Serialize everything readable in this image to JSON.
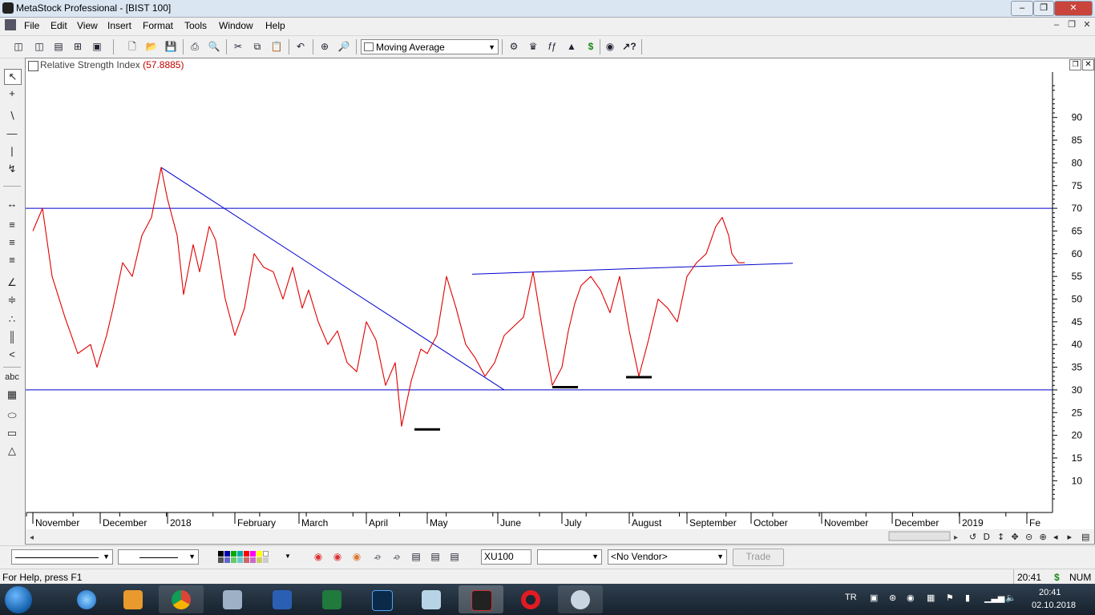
{
  "window": {
    "title": "MetaStock Professional - [BIST 100]"
  },
  "menubar": {
    "items": [
      "File",
      "Edit",
      "View",
      "Insert",
      "Format",
      "Tools",
      "Window",
      "Help"
    ]
  },
  "toolbar": {
    "indicator_select": "Moving Average"
  },
  "chart": {
    "title": "Relative Strength Index",
    "value_display": "(57.8885)",
    "line_color": "#e00000",
    "overlay_color": "#0000cc",
    "bg_color": "#ffffff"
  },
  "chart_data": {
    "type": "line",
    "title": "Relative Strength Index",
    "y_axis_position": "right",
    "ylim": [
      3,
      100
    ],
    "y_ticks": [
      10,
      15,
      20,
      25,
      30,
      35,
      40,
      45,
      50,
      55,
      60,
      65,
      70,
      75,
      80,
      85,
      90
    ],
    "x_tick_labels": [
      {
        "label": "November",
        "x": 0
      },
      {
        "label": "December",
        "x": 21
      },
      {
        "label": "2018",
        "x": 42
      },
      {
        "label": "February",
        "x": 63
      },
      {
        "label": "March",
        "x": 83
      },
      {
        "label": "April",
        "x": 104
      },
      {
        "label": "May",
        "x": 123
      },
      {
        "label": "June",
        "x": 145
      },
      {
        "label": "July",
        "x": 165
      },
      {
        "label": "August",
        "x": 186
      },
      {
        "label": "September",
        "x": 204
      },
      {
        "label": "October",
        "x": 224
      },
      {
        "label": "November",
        "x": 246
      },
      {
        "label": "December",
        "x": 268
      },
      {
        "label": "2019",
        "x": 289
      },
      {
        "label": "Fe",
        "x": 310
      }
    ],
    "series": [
      {
        "x": [
          0,
          3,
          6,
          10,
          14,
          18,
          20,
          23,
          25,
          28,
          31,
          34,
          37,
          40,
          42,
          45,
          47,
          50,
          52,
          55,
          57,
          60,
          63,
          66,
          69,
          72,
          75,
          78,
          81,
          84,
          86,
          89,
          92,
          95,
          98,
          101,
          104,
          107,
          110,
          113,
          115,
          118,
          121,
          123,
          126,
          129,
          132,
          135,
          138,
          141,
          144,
          147,
          150,
          153,
          156,
          159,
          162,
          165,
          167,
          169,
          171,
          174,
          177,
          180,
          183,
          186,
          189,
          192,
          195,
          198,
          201,
          204,
          207,
          210,
          213,
          215,
          217,
          218,
          220,
          222
        ],
        "y": [
          65,
          70,
          55,
          46,
          38,
          40,
          35,
          42,
          48,
          58,
          55,
          64,
          68,
          79,
          72,
          64,
          51,
          62,
          56,
          66,
          63,
          50,
          42,
          48,
          60,
          57,
          56,
          50,
          57,
          48,
          52,
          45,
          40,
          43,
          36,
          34,
          45,
          41,
          31,
          36,
          22,
          32,
          39,
          38,
          42,
          55,
          48,
          40,
          37,
          33,
          36,
          42,
          44,
          46,
          56,
          43,
          31,
          35,
          43,
          49,
          53,
          55,
          52,
          47,
          55,
          43,
          33,
          41,
          50,
          48,
          45,
          55,
          58,
          60,
          66,
          68,
          64,
          60,
          58,
          58
        ]
      }
    ],
    "reference_lines": [
      70,
      30
    ],
    "trendlines": [
      {
        "from": [
          40,
          79
        ],
        "to": [
          147,
          30
        ]
      },
      {
        "from": [
          137,
          55.5
        ],
        "to": [
          237,
          57.9
        ]
      }
    ],
    "support_marks": [
      {
        "x": 123,
        "y": 21.3
      },
      {
        "x": 166,
        "y": 30.6
      },
      {
        "x": 189,
        "y": 32.8
      }
    ],
    "x_range": [
      -2,
      318
    ],
    "grid": false,
    "legend": "none"
  },
  "bottombar": {
    "symbol_field": "XU100",
    "vendor_select": "<No Vendor>",
    "trade_button": "Trade"
  },
  "statusbar": {
    "help": "For Help, press F1",
    "time": "20:41",
    "dollar": "$",
    "num": "NUM"
  },
  "taskbar": {
    "lang": "TR",
    "clock_time": "20:41",
    "clock_date": "02.10.2018"
  }
}
